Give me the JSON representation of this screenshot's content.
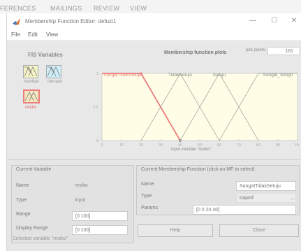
{
  "ribbon": {
    "tabs": [
      "FERENCES",
      "MAILINGS",
      "REVIEW",
      "VIEW"
    ]
  },
  "window": {
    "title": "Membership Function Editor: defuzi1",
    "controls": {
      "minimize": "—",
      "maximize": "☐",
      "close": "✕"
    }
  },
  "menu": {
    "items": [
      "File",
      "Edit",
      "View"
    ]
  },
  "fis_panel": {
    "title": "FIS Variables",
    "inputs": [
      "manfaat",
      "dampak"
    ],
    "output": "resiko"
  },
  "plot": {
    "title": "Membership function plots",
    "plot_points_label": "plot points:",
    "plot_points_value": "181",
    "x_axis_label": "input variable \"resiko\"",
    "y_ticks": [
      "1",
      "0.5",
      "0"
    ]
  },
  "chart_data": {
    "type": "line",
    "xlim": [
      0,
      100
    ],
    "ylim": [
      0,
      1
    ],
    "x_ticks": [
      0,
      10,
      20,
      30,
      40,
      50,
      60,
      70,
      80,
      90,
      100
    ],
    "series": [
      {
        "name": "SangatTidakSetuju",
        "mf": "trapmf",
        "params": [
          0,
          0,
          20,
          40
        ],
        "selected": true
      },
      {
        "name": "TidakSetuju",
        "mf": "trimf",
        "params": [
          20,
          40,
          60
        ],
        "selected": false
      },
      {
        "name": "Setuju",
        "mf": "trimf",
        "params": [
          40,
          60,
          80
        ],
        "selected": false
      },
      {
        "name": "Sangat_Setuju",
        "mf": "trapmf",
        "params": [
          60,
          80,
          100,
          100
        ],
        "selected": false
      }
    ],
    "colors": {
      "selected": "#ec7b7b",
      "normal": "#999999"
    }
  },
  "current_variable": {
    "header": "Current Variable",
    "name_label": "Name",
    "name_value": "resiko",
    "type_label": "Type",
    "type_value": "input",
    "range_label": "Range",
    "range_value": "[0 100]",
    "display_range_label": "Display Range",
    "display_range_value": "[0 100]"
  },
  "current_mf": {
    "header": "Current Membership Function (click on MF to select)",
    "name_label": "Name",
    "name_value": "SangatTidakSetuju",
    "type_label": "Type",
    "type_value": "trapmf",
    "params_label": "Params",
    "params_value": "[0 0 20 40]"
  },
  "buttons": {
    "help": "Help",
    "close": "Close"
  },
  "status": "Selected variable \"resiko\""
}
